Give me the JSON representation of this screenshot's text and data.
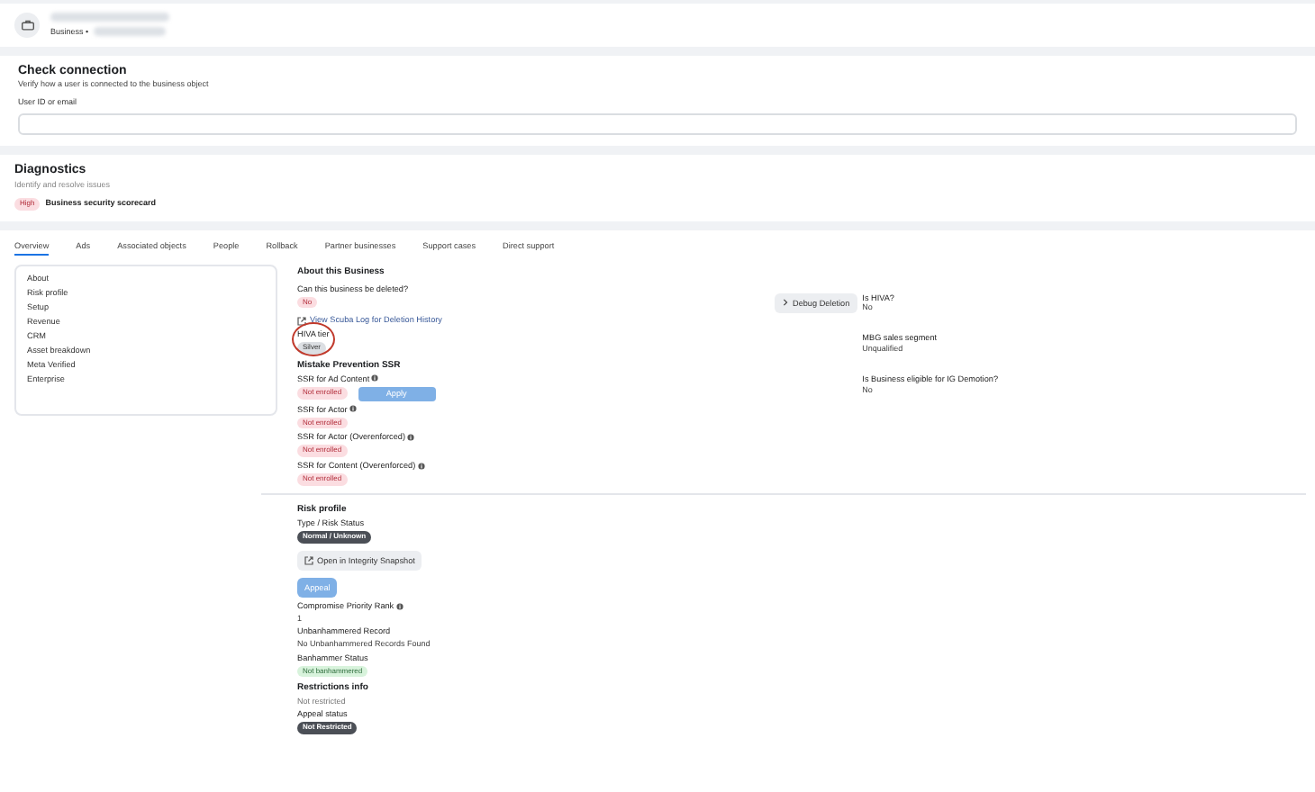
{
  "header": {
    "subtitle": "Business •"
  },
  "check_connection": {
    "title": "Check connection",
    "description": "Verify how a user is connected to the business object",
    "field_label": "User ID or email"
  },
  "diagnostics": {
    "title": "Diagnostics",
    "description": "Identify and resolve issues",
    "issues": [
      {
        "severity": "High",
        "label": "Business security scorecard"
      }
    ]
  },
  "tabs": [
    {
      "label": "Overview",
      "selected": true
    },
    {
      "label": "Ads",
      "selected": false
    },
    {
      "label": "Associated objects",
      "selected": false
    },
    {
      "label": "People",
      "selected": false
    },
    {
      "label": "Rollback",
      "selected": false
    },
    {
      "label": "Partner businesses",
      "selected": false
    },
    {
      "label": "Support cases",
      "selected": false
    },
    {
      "label": "Direct support",
      "selected": false
    }
  ],
  "side_nav": [
    "About",
    "Risk profile",
    "Setup",
    "Revenue",
    "CRM",
    "Asset breakdown",
    "Meta Verified",
    "Enterprise"
  ],
  "about": {
    "title": "About this Business",
    "items": [
      {
        "kind": "field",
        "label": "Can this business be deleted?",
        "tag": {
          "text": "No",
          "color": "#fbdde1"
        }
      },
      {
        "kind": "link",
        "text": "View Scuba Log for Deletion History"
      },
      {
        "kind": "field",
        "label": "HIVA tier",
        "tag": {
          "text": "Silver",
          "color": "#dcdfe3"
        },
        "circled": true
      },
      {
        "kind": "heading",
        "text": "Mistake Prevention SSR"
      },
      {
        "kind": "field",
        "label": "SSR for Ad Content",
        "info": true,
        "tag": {
          "text": "Not enrolled",
          "color": "#fbdde1"
        },
        "action": "Apply"
      },
      {
        "kind": "field",
        "label": "SSR for Actor",
        "info": true,
        "tag": {
          "text": "Not enrolled",
          "color": "#fbdde1"
        }
      },
      {
        "kind": "field",
        "label": "SSR for Actor (Overenforced)",
        "info": true,
        "tag": {
          "text": "Not enrolled",
          "color": "#fbdde1"
        }
      },
      {
        "kind": "field",
        "label": "SSR for Content (Overenforced)",
        "info": true,
        "tag": {
          "text": "Not enrolled",
          "color": "#fbdde1"
        }
      },
      {
        "kind": "divider"
      },
      {
        "kind": "heading",
        "text": "Risk profile"
      },
      {
        "kind": "field",
        "label": "Type / Risk Status",
        "tag": {
          "text": "Normal / Unknown",
          "color": "#4b4f56"
        }
      },
      {
        "kind": "button",
        "text": "Open in Integrity Snapshot"
      },
      {
        "kind": "primary",
        "text": "Appeal"
      },
      {
        "kind": "field",
        "label": "Compromise Priority Rank",
        "info": true,
        "value": "1"
      },
      {
        "kind": "field",
        "label": "Unbanhammered Record",
        "value": "No Unbanhammered Records Found"
      },
      {
        "kind": "field",
        "label": "Banhammer Status",
        "tag": {
          "text": "Not banhammered",
          "color": "#d8f3dc"
        }
      },
      {
        "kind": "heading",
        "text": "Restrictions info",
        "value": "Not restricted"
      },
      {
        "kind": "field",
        "label": "Appeal status",
        "tag": {
          "text": "Not Restricted",
          "color": "#4b4f56"
        }
      }
    ]
  },
  "debug_button": "Debug Deletion",
  "side_fields": [
    {
      "label": "Is HIVA?",
      "value": "No"
    },
    {
      "label": "MBG sales segment",
      "value": "Unqualified"
    },
    {
      "label": "Is Business eligible for IG Demotion?",
      "value": "No"
    }
  ]
}
